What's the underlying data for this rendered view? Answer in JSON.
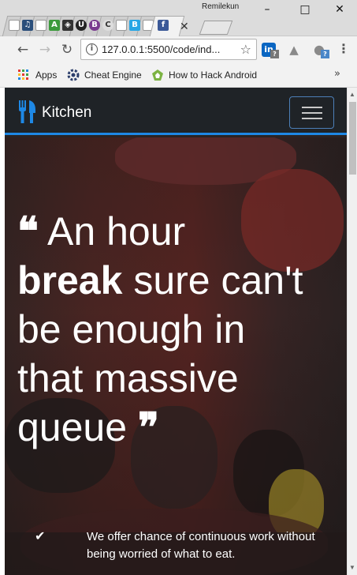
{
  "window": {
    "profile_name": "Remilekun",
    "controls": {
      "minimize": "–",
      "maximize": "□",
      "close": "✕"
    },
    "favicons": [
      {
        "icon": "page-icon",
        "glyph": "",
        "color": "#ffffff"
      },
      {
        "icon": "music-icon",
        "glyph": "♫",
        "color": "#2a4e7a"
      },
      {
        "icon": "page-icon",
        "glyph": "",
        "color": "#ffffff"
      },
      {
        "icon": "android-icon",
        "glyph": "A",
        "color": "#3c9a3c"
      },
      {
        "icon": "codepen-icon",
        "glyph": "◈",
        "color": "#333333"
      },
      {
        "icon": "udemy-icon",
        "glyph": "U",
        "color": "#222222"
      },
      {
        "icon": "b-icon",
        "glyph": "B",
        "color": "#7a3b8f"
      },
      {
        "icon": "c-icon",
        "glyph": "C",
        "color": "#dddddd"
      },
      {
        "icon": "page-icon",
        "glyph": "",
        "color": "#ffffff"
      },
      {
        "icon": "bootstrap-icon",
        "glyph": "B",
        "color": "#27a6e5"
      },
      {
        "icon": "page-icon",
        "glyph": "",
        "color": "#ffffff"
      },
      {
        "icon": "facebook-icon",
        "glyph": "f",
        "color": "#3b5998"
      }
    ],
    "active_tab_close": "✕"
  },
  "toolbar": {
    "url": "127.0.0.1:5500/code/ind...",
    "info_glyph": "i",
    "extensions": [
      {
        "icon": "linkedin-icon",
        "glyph": "in",
        "color": "#0a66c2",
        "badge": "?"
      },
      {
        "icon": "drive-icon",
        "glyph": "▲",
        "color": "#8a8a8a",
        "badge": ""
      },
      {
        "icon": "chat-icon",
        "glyph": "●",
        "color": "#8a8a8a",
        "badge": "?"
      }
    ]
  },
  "bookmarks": {
    "items": [
      {
        "label": "Apps",
        "icon": "apps-grid-icon"
      },
      {
        "label": "Cheat Engine",
        "icon": "cheat-engine-icon"
      },
      {
        "label": "How to Hack Android",
        "icon": "android-green-icon"
      }
    ],
    "more": "»"
  },
  "site": {
    "brand": "Kitchen",
    "hero": {
      "quote_word_1": "An hour",
      "quote_bold": "break",
      "quote_rest_1": "sure can't",
      "quote_rest_2": "be enough in",
      "quote_rest_3": "that massive",
      "quote_rest_4": "queue",
      "open_quote": "❝",
      "close_quote": "❞"
    },
    "feature": {
      "check": "✔",
      "text": "We offer chance of continuous work without being worried of what to eat."
    }
  },
  "colors": {
    "accent": "#1e88e5",
    "navbar": "#1f2327",
    "toggler_border": "#4c7fb8"
  }
}
